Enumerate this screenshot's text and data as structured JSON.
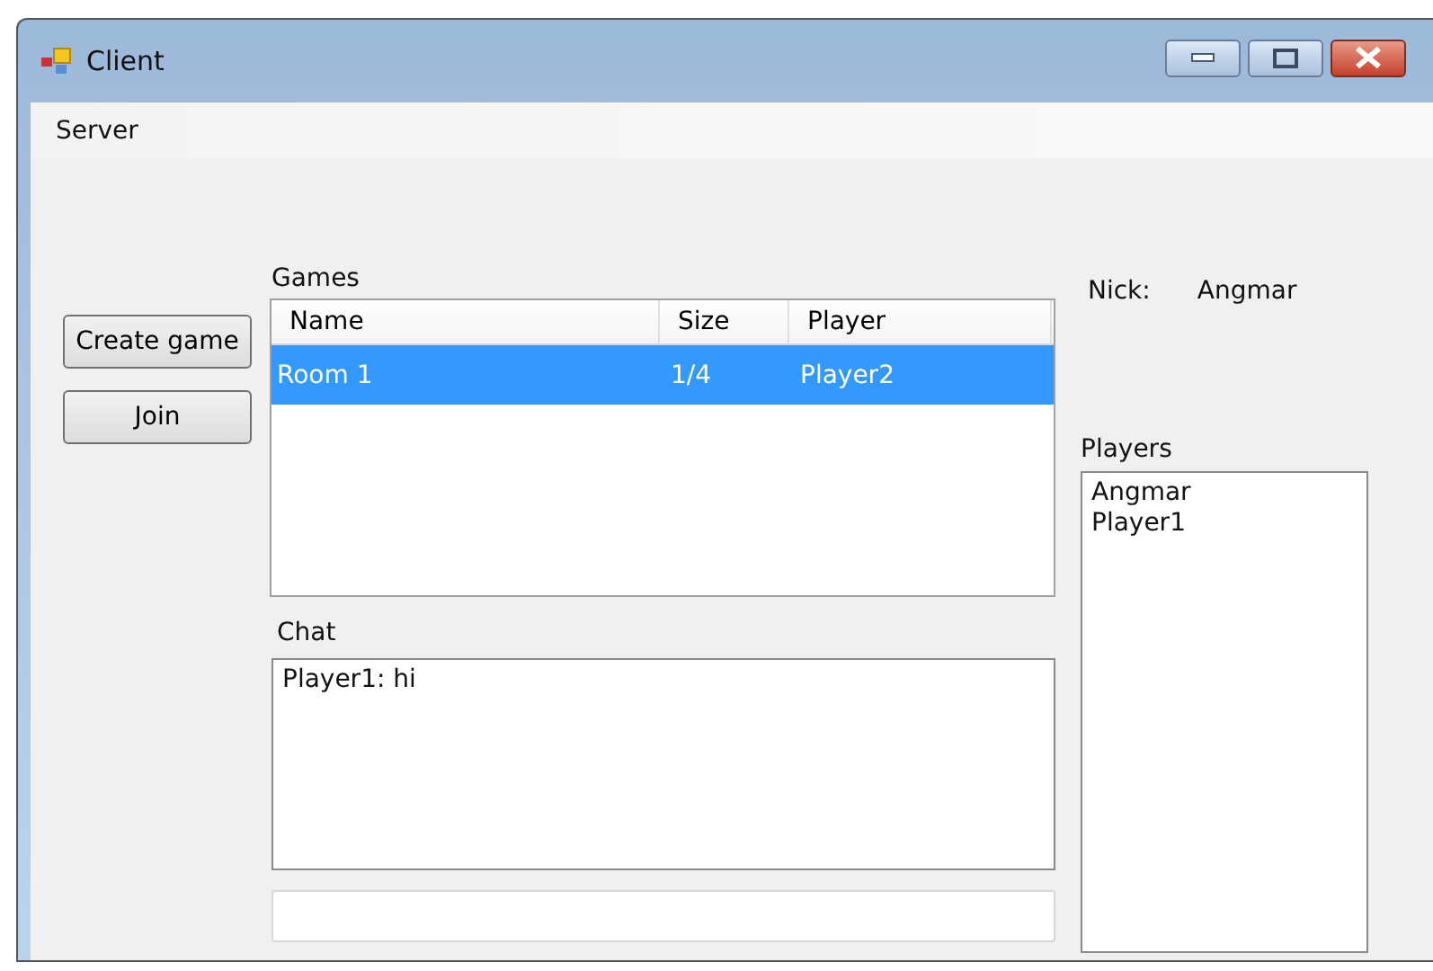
{
  "window": {
    "title": "Client"
  },
  "menu": [
    "Server"
  ],
  "buttons": [
    "Create game",
    "Join"
  ],
  "games": {
    "label": "Games",
    "columns": [
      "Name",
      "Size",
      "Player"
    ],
    "rows": [
      {
        "cells": [
          "Room 1",
          "1/4",
          "Player2"
        ],
        "selected": true
      }
    ]
  },
  "chat": {
    "label": "Chat",
    "messages": [
      "Player1: hi"
    ]
  },
  "nick": {
    "label": "Nick:",
    "value": "Angmar"
  },
  "players": {
    "label": "Players",
    "items": [
      "Angmar",
      "Player1"
    ]
  }
}
